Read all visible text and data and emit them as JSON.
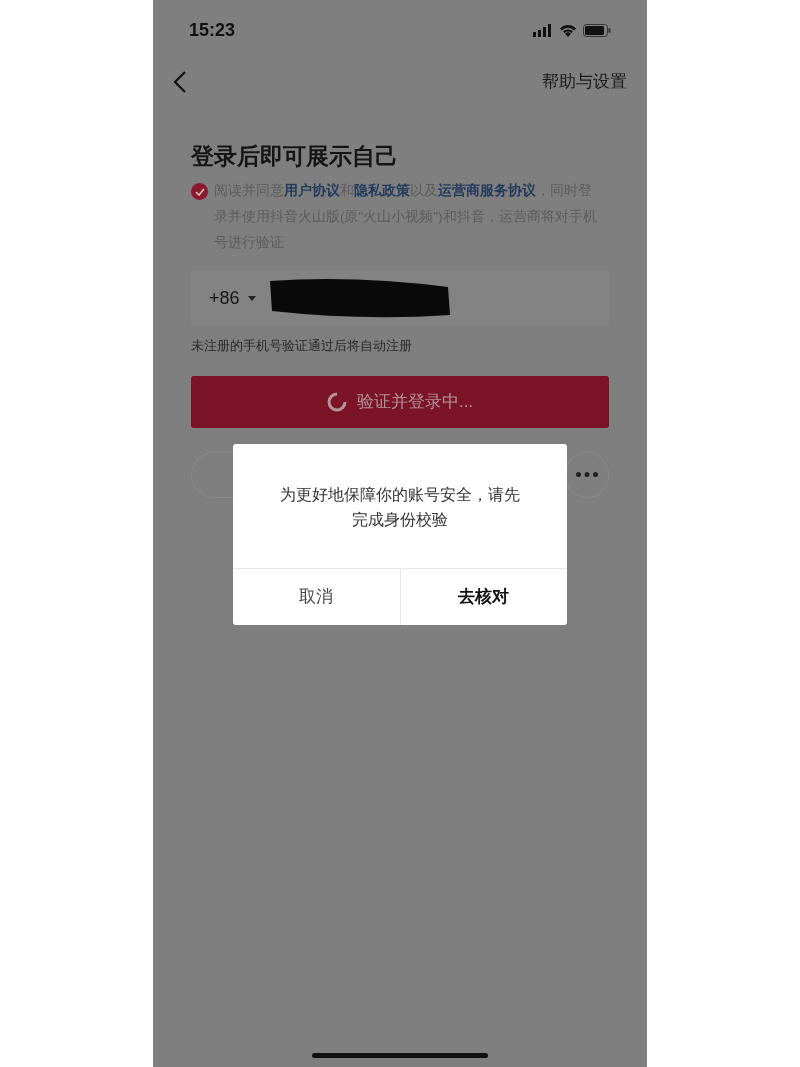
{
  "status_bar": {
    "time": "15:23"
  },
  "nav": {
    "right_link": "帮助与设置"
  },
  "title": "登录后即可展示自己",
  "agreement": {
    "checked": true,
    "parts": [
      {
        "text": "阅读并同意",
        "link": false
      },
      {
        "text": "用户协议",
        "link": true
      },
      {
        "text": "和",
        "link": false
      },
      {
        "text": "隐私政策",
        "link": true
      },
      {
        "text": "以及",
        "link": false
      },
      {
        "text": "运营商服务协议",
        "link": true
      },
      {
        "text": "，同时登录并使用抖音火山版(原\"火山小视频\")和抖音，运营商将对手机号进行验证",
        "link": false
      }
    ]
  },
  "phone_field": {
    "country_code": "+86"
  },
  "hint": "未注册的手机号验证通过后将自动注册",
  "login_button": {
    "label": "验证并登录中..."
  },
  "dialog": {
    "message": "为更好地保障你的账号安全，请先完成身份校验",
    "buttons": [
      {
        "label": "取消",
        "primary": false
      },
      {
        "label": "去核对",
        "primary": true
      }
    ]
  }
}
